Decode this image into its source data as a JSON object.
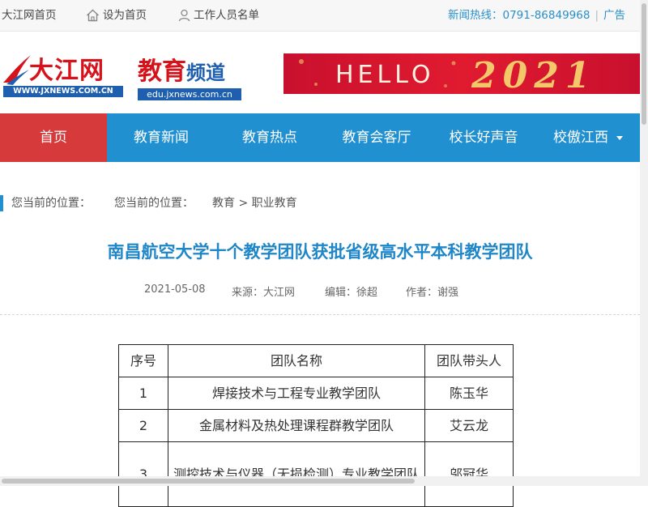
{
  "topbar": {
    "home_link": "大江网首页",
    "set_home": "设为首页",
    "staff_list": "工作人员名单",
    "hotline": "新闻热线：0791-86849968",
    "ad": "广告"
  },
  "header": {
    "logo_cn": "大江网",
    "logo_url": "WWW.JXNEWS.COM.CN",
    "channel_part1": "教育",
    "channel_part2": "频道",
    "channel_url": "edu.jxnews.com.cn",
    "banner_text": "HELLO",
    "banner_year": "2021"
  },
  "nav": {
    "items": [
      {
        "label": "首页"
      },
      {
        "label": "教育新闻"
      },
      {
        "label": "教育热点"
      },
      {
        "label": "教育会客厅"
      },
      {
        "label": "校长好声音"
      },
      {
        "label": "校傲江西"
      }
    ]
  },
  "breadcrumb": {
    "label1": "您当前的位置：",
    "label2": "您当前的位置：",
    "path": "教育 > 职业教育"
  },
  "article": {
    "title": "南昌航空大学十个教学团队获批省级高水平本科教学团队",
    "date": "2021-05-08",
    "source": "来源：大江网",
    "editor": "编辑：徐超",
    "author": "作者：谢强"
  },
  "table": {
    "headers": [
      "序号",
      "团队名称",
      "团队带头人"
    ],
    "rows": [
      [
        "1",
        "焊接技术与工程专业教学团队",
        "陈玉华"
      ],
      [
        "2",
        "金属材料及热处理课程群教学团队",
        "艾云龙"
      ],
      [
        "3",
        "测控技术与仪器（无损检测）专业教学团队",
        "邬冠华"
      ]
    ]
  },
  "colors": {
    "nav_bg": "#2190d0",
    "nav_active": "#d63a3a",
    "title": "#1f86c8",
    "brand_red": "#d6131b",
    "brand_blue": "#1e5fb0"
  }
}
